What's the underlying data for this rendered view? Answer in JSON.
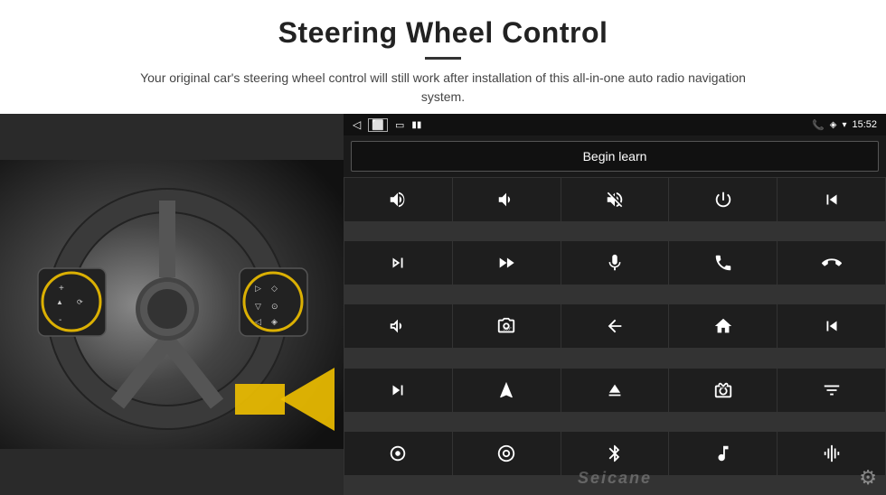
{
  "header": {
    "title": "Steering Wheel Control",
    "subtitle": "Your original car's steering wheel control will still work after installation of this all-in-one auto radio navigation system.",
    "divider": true
  },
  "statusbar": {
    "back_icon": "◁",
    "home_icon": "○",
    "recents_icon": "□",
    "battery_icon": "▮▮",
    "phone_icon": "📞",
    "location_icon": "◈",
    "wifi_icon": "▾",
    "time": "15:52"
  },
  "begin_learn": {
    "label": "Begin learn"
  },
  "controls": [
    {
      "id": "vol_up",
      "symbol": "vol_up"
    },
    {
      "id": "vol_down",
      "symbol": "vol_down"
    },
    {
      "id": "mute",
      "symbol": "mute"
    },
    {
      "id": "power",
      "symbol": "power"
    },
    {
      "id": "prev_track_phone",
      "symbol": "prev_track_phone"
    },
    {
      "id": "next_track",
      "symbol": "next_track"
    },
    {
      "id": "fast_forward",
      "symbol": "fast_forward"
    },
    {
      "id": "mic",
      "symbol": "mic"
    },
    {
      "id": "phone",
      "symbol": "phone"
    },
    {
      "id": "hang_up",
      "symbol": "hang_up"
    },
    {
      "id": "horn",
      "symbol": "horn"
    },
    {
      "id": "360",
      "symbol": "360"
    },
    {
      "id": "back",
      "symbol": "back"
    },
    {
      "id": "home",
      "symbol": "home"
    },
    {
      "id": "prev_track2",
      "symbol": "prev_track2"
    },
    {
      "id": "fast_fwd2",
      "symbol": "fast_fwd2"
    },
    {
      "id": "nav",
      "symbol": "nav"
    },
    {
      "id": "eject",
      "symbol": "eject"
    },
    {
      "id": "radio",
      "symbol": "radio"
    },
    {
      "id": "eq",
      "symbol": "eq"
    },
    {
      "id": "mic2",
      "symbol": "mic2"
    },
    {
      "id": "360_2",
      "symbol": "360_2"
    },
    {
      "id": "bluetooth",
      "symbol": "bluetooth"
    },
    {
      "id": "music",
      "symbol": "music"
    },
    {
      "id": "equalizer",
      "symbol": "equalizer"
    }
  ],
  "watermark": "Seicane",
  "gear_icon": "⚙"
}
